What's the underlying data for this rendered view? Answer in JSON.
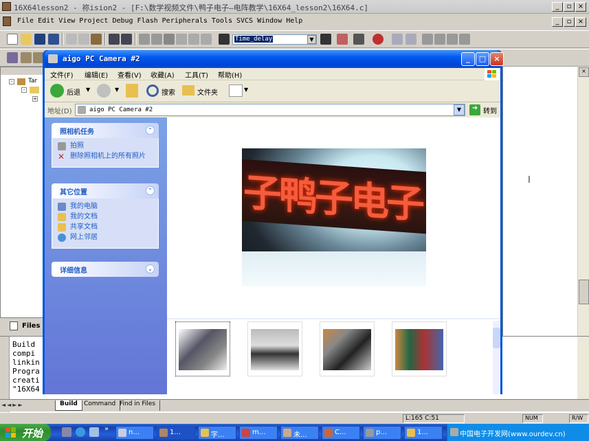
{
  "keil": {
    "title": "16X64lesson2  - 祢ision2 - [F:\\数学视频文件\\鸭子电子—电阵教学\\16X64_lesson2\\16X64.c]",
    "menu": [
      "File",
      "Edit",
      "View",
      "Project",
      "Debug",
      "Flash",
      "Peripherals",
      "Tools",
      "SVCS",
      "Window",
      "Help"
    ],
    "combo_value": "Time_delay",
    "tree_root": "Tar",
    "files_tab": "Files",
    "output_lines": [
      "Build",
      "compi",
      "linkin",
      "Progra",
      "creati",
      "\"16X64"
    ],
    "output_tabs": [
      "Build",
      "Command",
      "Find in Files"
    ],
    "status_pos": "L:165 C:51",
    "status_num": "NUM",
    "status_rw": "R/W"
  },
  "xp": {
    "title": "aigo PC Camera #2",
    "menu": [
      "文件(F)",
      "编辑(E)",
      "查看(V)",
      "收藏(A)",
      "工具(T)",
      "帮助(H)"
    ],
    "back": "后退",
    "search": "搜索",
    "folders": "文件夹",
    "address_label": "地址(D)",
    "address_value": "aigo PC Camera #2",
    "go": "转到",
    "panel1_title": "照相机任务",
    "panel1_items": [
      "拍照",
      "删除照相机上的所有照片"
    ],
    "panel2_title": "其它位置",
    "panel2_items": [
      "我的电脑",
      "我的文档",
      "共享文档",
      "网上邻居"
    ],
    "panel3_title": "详细信息",
    "preview_text": "子鸭子电子"
  },
  "taskbar": {
    "start": "开始",
    "items": [
      "n...",
      "1...",
      "字...",
      "m...",
      "未...",
      "C...",
      "p...",
      "1..."
    ],
    "watermark": "中国电子开发网(www.ourdev.cn)"
  },
  "colors": {
    "xp_blue": "#0054e3",
    "led_red": "#ff5a3c",
    "task_blue": "#245edb",
    "start_green": "#3c9e3c"
  }
}
